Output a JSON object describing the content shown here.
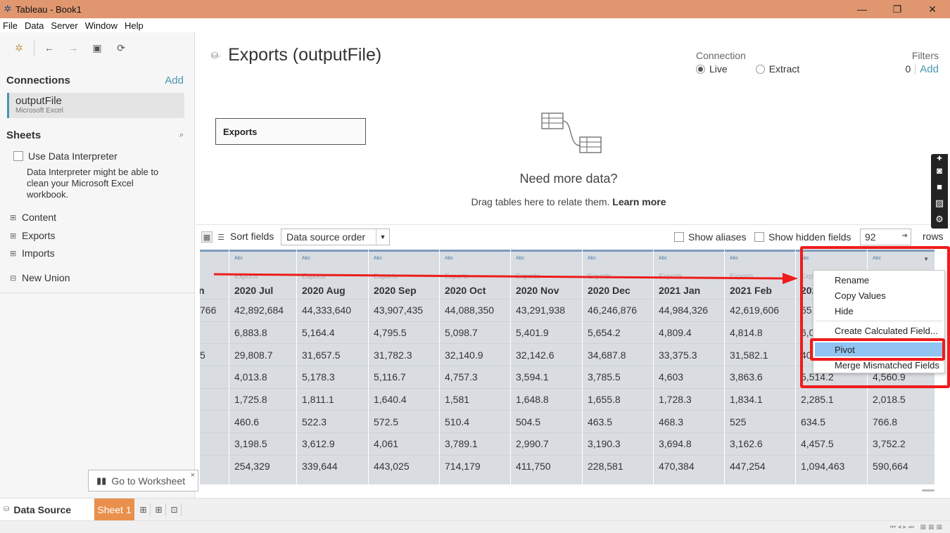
{
  "window": {
    "title": "Tableau - Book1",
    "app_icon": "tableau-icon",
    "minimize": "—",
    "restore": "❐",
    "close": "✕"
  },
  "menu": [
    "File",
    "Data",
    "Server",
    "Window",
    "Help"
  ],
  "left": {
    "connections_heading": "Connections",
    "connections_add": "Add",
    "connection": {
      "name": "outputFile",
      "type": "Microsoft Excel"
    },
    "sheets_heading": "Sheets",
    "interpreter_label": "Use Data Interpreter",
    "interpreter_desc": "Data Interpreter might be able to clean your Microsoft Excel workbook.",
    "sheets": [
      "Content",
      "Exports",
      "Imports"
    ],
    "new_union": "New Union"
  },
  "main": {
    "datasource_title": "Exports (outputFile)",
    "connection_heading": "Connection",
    "conn_live": "Live",
    "conn_extract": "Extract",
    "filters_heading": "Filters",
    "filters_count": "0",
    "filters_add": "Add",
    "canvas_table": "Exports",
    "need_more": "Need more data?",
    "drag_text": "Drag tables here to relate them.",
    "learn_more": "Learn more"
  },
  "grid_toolbar": {
    "sort_label": "Sort fields",
    "sort_value": "Data source order",
    "show_aliases": "Show aliases",
    "show_hidden": "Show hidden fields",
    "rows_value": "92",
    "rows_label": "rows"
  },
  "grid": {
    "type_label": "Abc",
    "source_label": "Exports",
    "partial_first_col": {
      "name": "n",
      "cells": [
        "766",
        "",
        "5",
        "",
        "",
        "",
        "",
        ""
      ]
    },
    "columns": [
      {
        "name": "2020 Jul",
        "cells": [
          "42,892,684",
          "6,883.8",
          "29,808.7",
          "4,013.8",
          "1,725.8",
          "460.6",
          "3,198.5",
          "254,329"
        ]
      },
      {
        "name": "2020 Aug",
        "cells": [
          "44,333,640",
          "5,164.4",
          "31,657.5",
          "5,178.3",
          "1,811.1",
          "522.3",
          "3,612.9",
          "339,644"
        ]
      },
      {
        "name": "2020 Sep",
        "cells": [
          "43,907,435",
          "4,795.5",
          "31,782.3",
          "5,116.7",
          "1,640.4",
          "572.5",
          "4,061",
          "443,025"
        ]
      },
      {
        "name": "2020 Oct",
        "cells": [
          "44,088,350",
          "5,098.7",
          "32,140.9",
          "4,757.3",
          "1,581",
          "510.4",
          "3,789.1",
          "714,179"
        ]
      },
      {
        "name": "2020 Nov",
        "cells": [
          "43,291,938",
          "5,401.9",
          "32,142.6",
          "3,594.1",
          "1,648.8",
          "504.5",
          "2,990.7",
          "411,750"
        ]
      },
      {
        "name": "2020 Dec",
        "cells": [
          "46,246,876",
          "5,654.2",
          "34,687.8",
          "3,785.5",
          "1,655.8",
          "463.5",
          "3,190.3",
          "228,581"
        ]
      },
      {
        "name": "2021 Jan",
        "cells": [
          "44,984,326",
          "4,809.4",
          "33,375.3",
          "4,603",
          "1,728.3",
          "468.3",
          "3,694.8",
          "470,384"
        ]
      },
      {
        "name": "2021 Feb",
        "cells": [
          "42,619,606",
          "4,814.8",
          "31,582.1",
          "3,863.6",
          "1,834.1",
          "525",
          "3,162.6",
          "447,254"
        ]
      },
      {
        "name": "202",
        "cells": [
          "55,4",
          "6,05",
          "40,",
          "5,514.2",
          "2,285.1",
          "634.5",
          "4,457.5",
          "1,094,463"
        ]
      },
      {
        "name": "",
        "cells": [
          "",
          "",
          "",
          "4,560.9",
          "2,018.5",
          "766.8",
          "3,752.2",
          "590,664"
        ]
      }
    ]
  },
  "context_menu": {
    "items": [
      "Rename",
      "Copy Values",
      "Hide",
      "Create Calculated Field...",
      "Pivot",
      "Merge Mismatched Fields"
    ],
    "highlighted": "Pivot"
  },
  "tooltip": {
    "goto_worksheet": "Go to Worksheet",
    "close": "×"
  },
  "tabs": {
    "data_source": "Data Source",
    "sheet1": "Sheet 1"
  },
  "colors": {
    "titlebar": "#E0976F",
    "accent": "#4996b2",
    "sheet_tab": "#E8904C",
    "highlight": "#91c4f2",
    "annotation": "#ee1c1c"
  }
}
